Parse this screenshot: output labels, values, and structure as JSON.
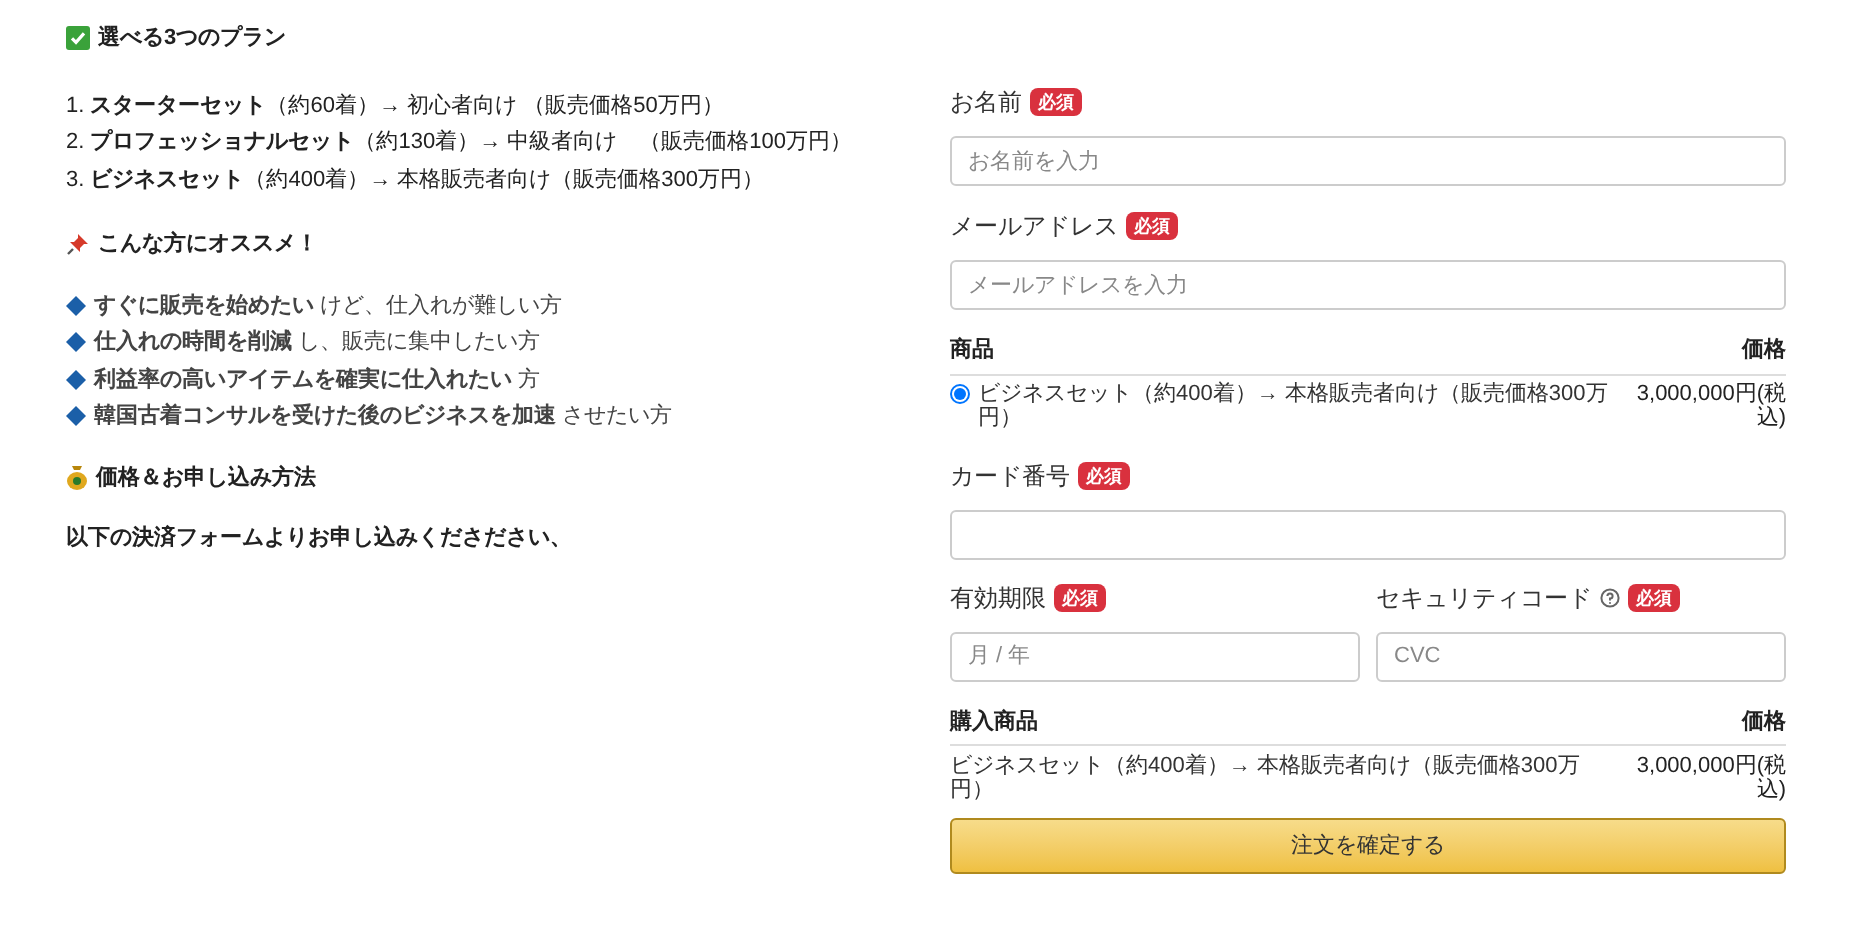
{
  "plans": {
    "title": "選べる3つのプラン",
    "items": [
      "1. **スターターセット**（約60着）→ 初心者向け （販売価格50万円）",
      "2. **プロフェッショナルセット**（約130着）→ 中級者向け　（販売価格100万円）",
      "3. **ビジネスセット**（約400着）→ 本格販売者向け（販売価格300万円）"
    ]
  },
  "recommend": {
    "title": "こんな方にオススメ！",
    "items": [
      "**すぐに販売を始めたい** けど、仕入れが難しい方",
      "**仕入れの時間を削減** し、販売に集中したい方",
      "**利益率の高いアイテムを確実に仕入れたい** 方",
      "**韓国古着コンサルを受けた後のビジネスを加速** させたい方"
    ]
  },
  "pricing": {
    "title": "価格＆お申し込み方法",
    "note": "以下の決済フォームよりお申し込みくださださい、"
  },
  "form": {
    "name": {
      "label": "お名前",
      "required": "必須",
      "placeholder": "お名前を入力"
    },
    "email": {
      "label": "メールアドレス",
      "required": "必須",
      "placeholder": "メールアドレスを入力"
    },
    "products": {
      "col_item": "商品",
      "col_price": "価格",
      "items": [
        {
          "name": "ビジネスセット（約400着）→ 本格販売者向け（販売価格300万円）",
          "price": "3,000,000円(税込)",
          "selected": true
        }
      ]
    },
    "card": {
      "label": "カード番号",
      "required": "必須"
    },
    "expiry": {
      "label": "有効期限",
      "required": "必須",
      "placeholder": "月 / 年"
    },
    "cvc": {
      "label": "セキュリティコード",
      "required": "必須",
      "placeholder": "CVC"
    },
    "summary": {
      "col_item": "購入商品",
      "col_price": "価格",
      "items": [
        {
          "name": "ビジネスセット（約400着）→ 本格販売者向け（販売価格300万円）",
          "price": "3,000,000円(税込)"
        }
      ]
    },
    "submit": "注文を確定する"
  }
}
